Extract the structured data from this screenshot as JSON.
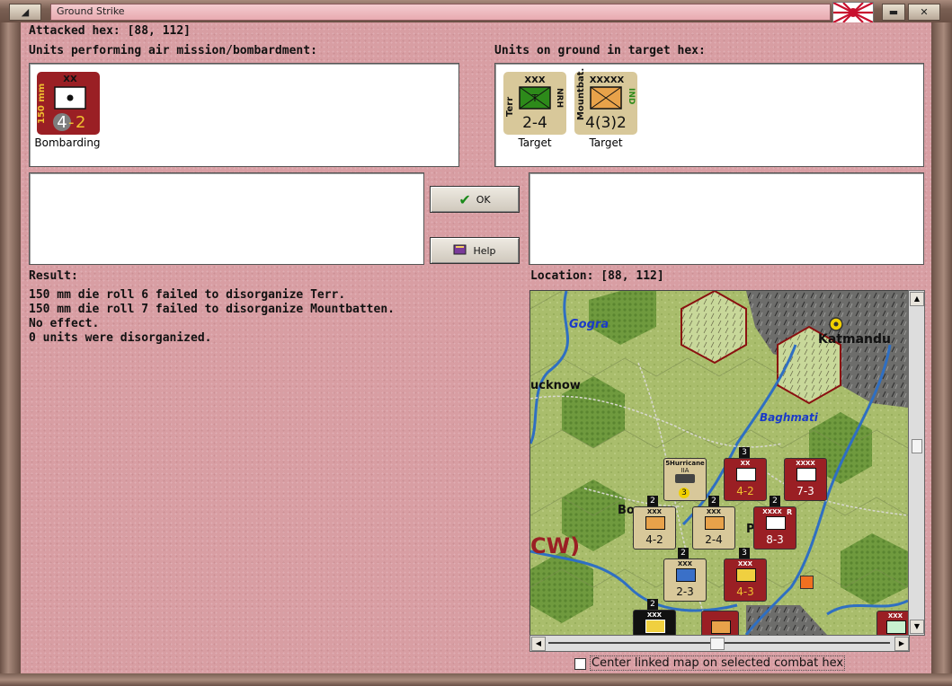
{
  "window": {
    "title": "Ground Strike"
  },
  "header": {
    "attacked_hex": "Attacked hex:  [88, 112]"
  },
  "air_units": {
    "label": "Units performing air mission/bombardment:",
    "units": [
      {
        "name": "150 mm",
        "size": "XX",
        "attack": "4",
        "defense": "2",
        "caption": "Bombarding",
        "color": "#9a1f24"
      }
    ]
  },
  "ground_units": {
    "label": "Units on ground in target hex:",
    "units": [
      {
        "name": "Terr",
        "size": "XXX",
        "suffix": "NRH",
        "values": "2-4",
        "caption": "Target",
        "color": "#d8c89a"
      },
      {
        "name": "Mountbat.",
        "size": "XXXXX",
        "suffix": "IND",
        "values": "4(3)2",
        "caption": "Target",
        "color": "#d8c89a"
      }
    ]
  },
  "buttons": {
    "ok": "OK",
    "help": "Help"
  },
  "result": {
    "label": "Result:",
    "lines": [
      "150 mm die roll 6 failed to disorganize Terr.",
      "150 mm die roll 7 failed to disorganize Mountbatten.",
      "No effect.",
      "0 units were disorganized."
    ]
  },
  "location": {
    "label": "Location:  [88, 112]"
  },
  "map": {
    "place_labels": [
      "Gogra",
      "Katmandu",
      "ucknow",
      "Baghmati",
      "Bo",
      "CW)",
      "P"
    ],
    "counters": [
      {
        "top": "5Hurricane",
        "mid": "IIA",
        "val": "3",
        "badge": ""
      },
      {
        "top": "XX",
        "mid": "",
        "val": "4-2",
        "badge": "3"
      },
      {
        "top": "XXXX",
        "mid": "",
        "val": "7-3",
        "badge": ""
      },
      {
        "top": "XXX",
        "mid": "",
        "val": "4-2",
        "badge": "2"
      },
      {
        "top": "XXX",
        "mid": "",
        "val": "2-4",
        "badge": "2"
      },
      {
        "top": "XXXX",
        "mid": "R",
        "val": "8-3",
        "badge": "2"
      },
      {
        "top": "XXX",
        "mid": "",
        "val": "2-3",
        "badge": "2"
      },
      {
        "top": "XXX",
        "mid": "",
        "val": "4-3",
        "badge": "3"
      },
      {
        "top": "XXX",
        "mid": "",
        "val": "",
        "badge": "2"
      },
      {
        "top": "XXX",
        "mid": "",
        "val": "",
        "badge": ""
      }
    ]
  },
  "footer": {
    "center_checkbox_label": "Center linked map on selected combat hex",
    "center_checkbox_checked": false
  },
  "colors": {
    "background": "#d89ea3",
    "unit_red": "#9a1f24",
    "unit_tan": "#d8c89a",
    "infantry_green": "#2d8a1a",
    "terrain_green": "#a9bd6c"
  }
}
